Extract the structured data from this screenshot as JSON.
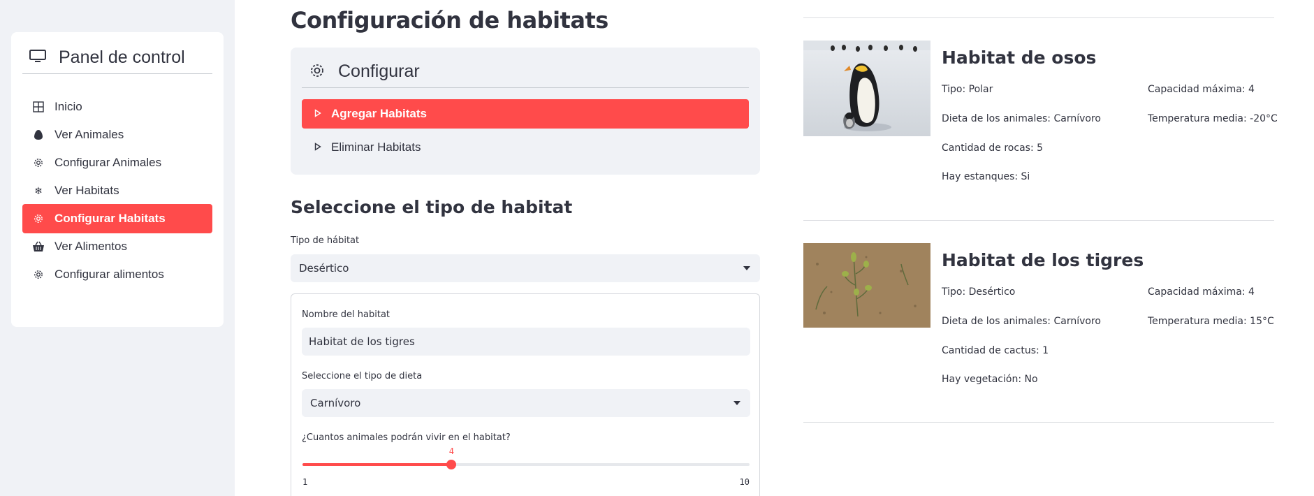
{
  "sidebar": {
    "title": "Panel de control",
    "items": [
      {
        "label": "Inicio",
        "icon": "grid-icon"
      },
      {
        "label": "Ver Animales",
        "icon": "egg-icon"
      },
      {
        "label": "Configurar Animales",
        "icon": "gear-icon"
      },
      {
        "label": "Ver Habitats",
        "icon": "snowflake-icon"
      },
      {
        "label": "Configurar Habitats",
        "icon": "gear-icon",
        "active": true
      },
      {
        "label": "Ver Alimentos",
        "icon": "basket-icon"
      },
      {
        "label": "Configurar alimentos",
        "icon": "gear-icon"
      }
    ]
  },
  "main": {
    "title": "Configuración de habitats",
    "config": {
      "title": "Configurar",
      "items": [
        {
          "label": "Agregar Habitats",
          "active": true
        },
        {
          "label": "Eliminar Habitats"
        }
      ]
    },
    "section_title": "Seleccione el tipo de habitat",
    "habitat_type": {
      "label": "Tipo de hábitat",
      "value": "Desértico"
    },
    "form": {
      "name_label": "Nombre del habitat",
      "name_value": "Habitat de los tigres",
      "diet_label": "Seleccione el tipo de dieta",
      "diet_value": "Carnívoro",
      "capacity_label": "¿Cuantos animales podrán vivir en el habitat?",
      "capacity_value": "4",
      "capacity_min": "1",
      "capacity_max": "10"
    }
  },
  "habitats": [
    {
      "title": "Habitat de osos",
      "image": "penguin-photo",
      "left": [
        "Tipo: Polar",
        "Dieta de los animales: Carnívoro",
        "Cantidad de rocas: 5",
        "Hay estanques: Si"
      ],
      "right": [
        "Capacidad máxima: 4",
        "Temperatura media: -20°C"
      ]
    },
    {
      "title": "Habitat de los tigres",
      "image": "desert-plant-photo",
      "left": [
        "Tipo: Desértico",
        "Dieta de los animales: Carnívoro",
        "Cantidad de cactus: 1",
        "Hay vegetación: No"
      ],
      "right": [
        "Capacidad máxima: 4",
        "Temperatura media: 15°C"
      ]
    }
  ],
  "colors": {
    "accent": "#ff4b4b",
    "sidebar_bg": "#f0f2f6",
    "text": "#31333f"
  }
}
